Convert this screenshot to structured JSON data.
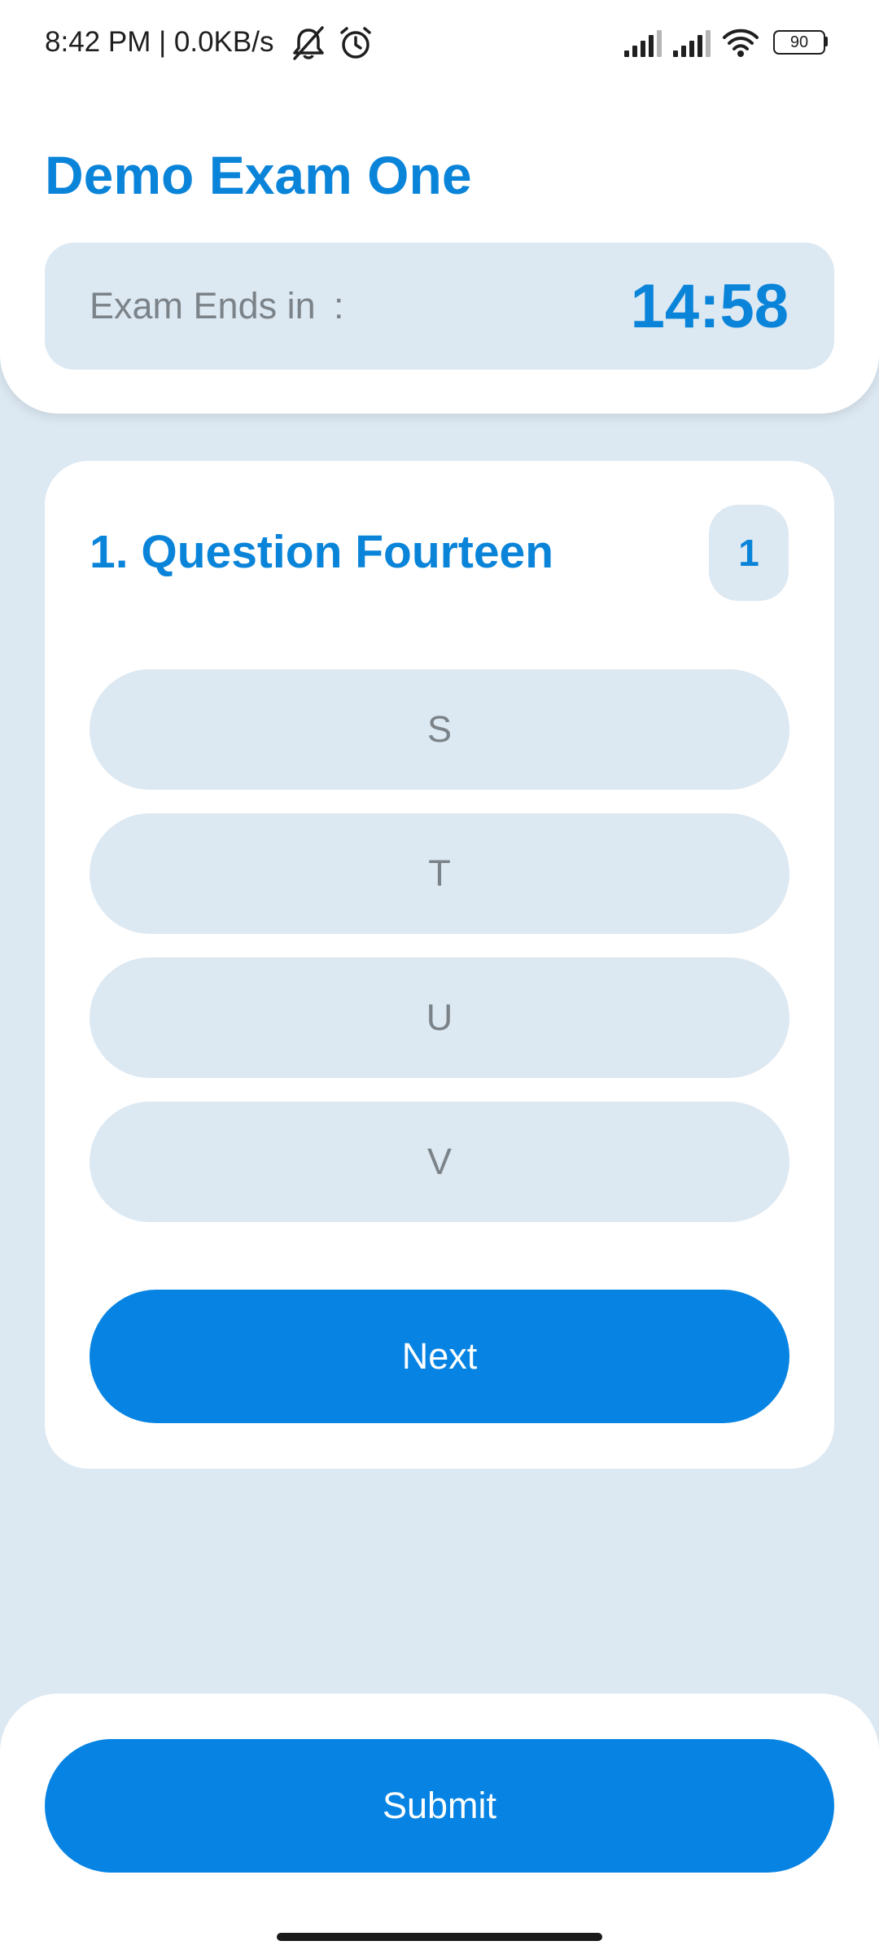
{
  "status_bar": {
    "time_and_speed": "8:42 PM | 0.0KB/s",
    "battery_level": "90",
    "icons": [
      "notifications-muted-icon",
      "alarm-icon",
      "cell-signal-icon",
      "cell-signal-icon",
      "wifi-icon",
      "battery-icon"
    ]
  },
  "header": {
    "title": "Demo Exam One",
    "timer_label": "Exam Ends in",
    "timer_separator": ":",
    "timer_value": "14:58"
  },
  "question": {
    "title": "1. Question Fourteen",
    "badge": "1",
    "options": [
      "S",
      "T",
      "U",
      "V"
    ],
    "next_label": "Next"
  },
  "footer": {
    "submit_label": "Submit"
  },
  "colors": {
    "accent": "#0784e3",
    "title_blue": "#0a84d9",
    "background": "#dce8f2",
    "muted_text": "#7b8388",
    "surface": "#ffffff"
  }
}
